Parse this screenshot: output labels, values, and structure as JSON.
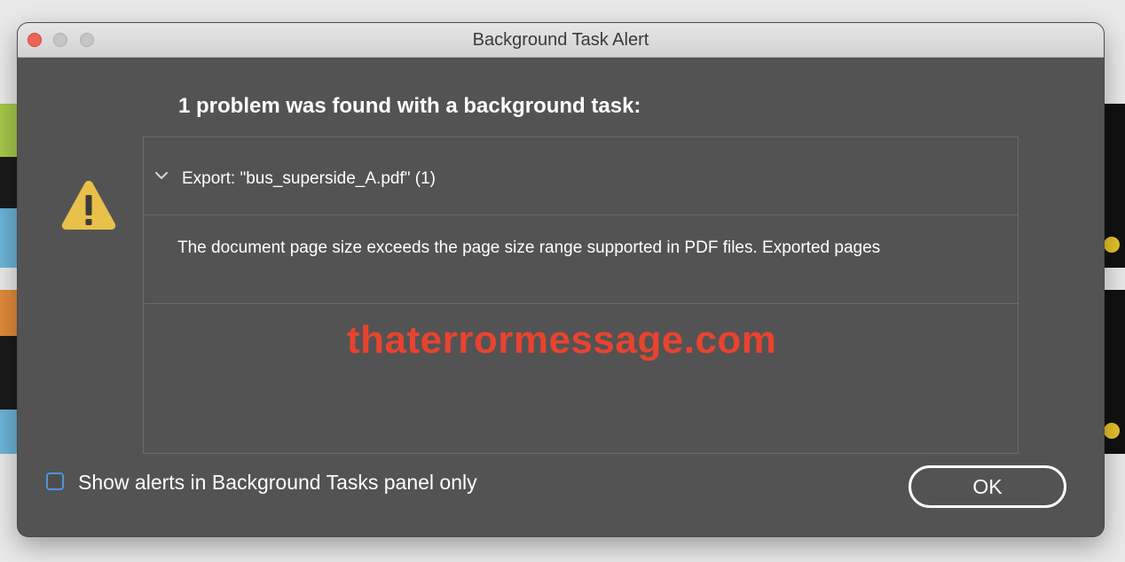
{
  "window": {
    "title": "Background Task Alert"
  },
  "dialog": {
    "heading": "1 problem was found with a background task:",
    "export_item_label": "Export: \"bus_superside_A.pdf\" (1)",
    "message": "The document page size exceeds the page size range supported in PDF files. Exported pages",
    "watermark": "thaterrormessage.com",
    "checkbox_label": "Show alerts in Background Tasks panel only",
    "checkbox_checked": false,
    "ok_label": "OK"
  },
  "icons": {
    "warning": "warning-icon",
    "disclosure": "chevron-down-icon"
  },
  "colors": {
    "dialog_bg": "#535353",
    "warning_yellow": "#e8c04a",
    "watermark_red": "#e8432f",
    "checkbox_blue": "#4f95d9",
    "close_red": "#ec6559"
  }
}
